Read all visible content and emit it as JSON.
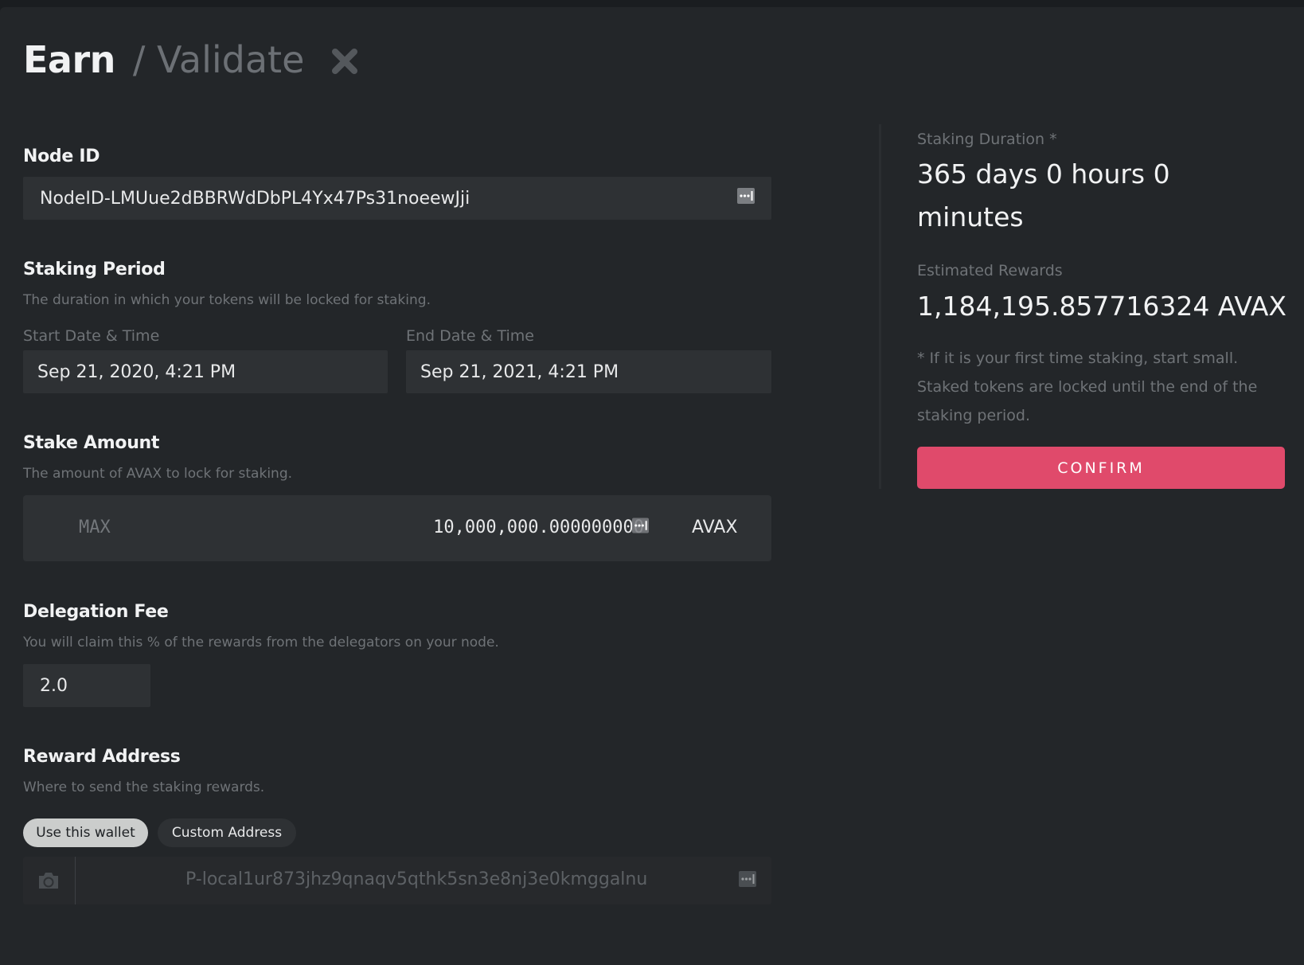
{
  "header": {
    "title": "Earn",
    "subtitle": "/ Validate",
    "close_icon": "close-icon"
  },
  "node_id": {
    "label": "Node ID",
    "value": "NodeID-LMUue2dBBRWdDbPL4Yx47Ps31noeewJji",
    "icon": "input-text-icon"
  },
  "staking_period": {
    "label": "Staking Period",
    "description": "The duration in which your tokens will be locked for staking.",
    "start_label": "Start Date & Time",
    "start_value": "Sep 21, 2020, 4:21 PM",
    "end_label": "End Date & Time",
    "end_value": "Sep 21, 2021, 4:21 PM"
  },
  "stake_amount": {
    "label": "Stake Amount",
    "description": "The amount of AVAX to lock for staking.",
    "max_label": "MAX",
    "value": "10,000,000.000000000",
    "unit": "AVAX"
  },
  "delegation_fee": {
    "label": "Delegation Fee",
    "description": "You will claim this % of the rewards from the delegators on your node.",
    "value": "2.0"
  },
  "reward_address": {
    "label": "Reward Address",
    "description": "Where to send the staking rewards.",
    "options": [
      {
        "label": "Use this wallet",
        "active": true
      },
      {
        "label": "Custom Address",
        "active": false
      }
    ],
    "address": "P-local1ur873jhz9qnaqv5qthk5sn3e8nj3e0kmggalnu",
    "scan_icon": "camera-icon"
  },
  "summary": {
    "duration_label": "Staking Duration *",
    "duration_value": "365 days 0 hours 0 minutes",
    "rewards_label": "Estimated Rewards",
    "rewards_value": "1,184,195.857716324 AVAX",
    "note": "* If it is your first time staking, start small. Staked tokens are locked until the end of the staking period.",
    "confirm_label": "CONFIRM"
  },
  "colors": {
    "accent": "#e04a6b",
    "background": "#232629",
    "input": "#2e3134"
  }
}
